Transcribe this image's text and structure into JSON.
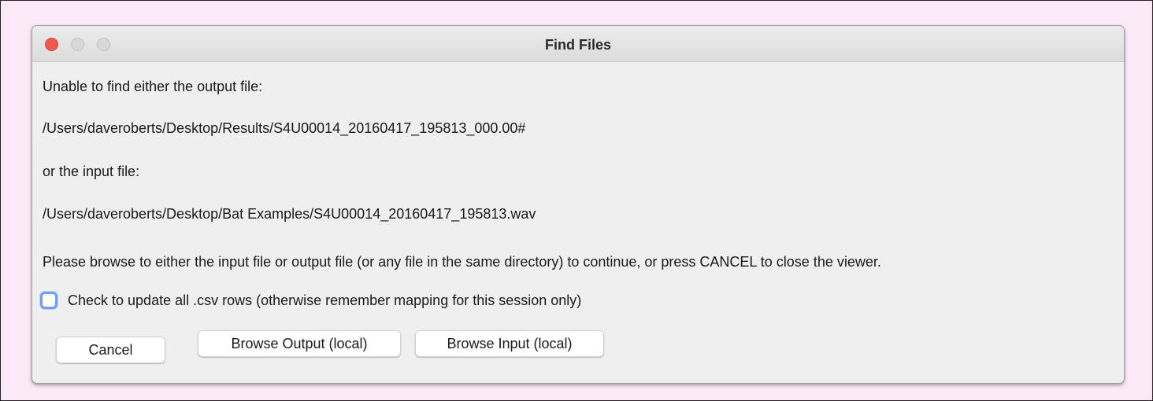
{
  "window": {
    "title": "Find Files"
  },
  "message": {
    "line1": "Unable to find either the output file:",
    "output_path": "/Users/daveroberts/Desktop/Results/S4U00014_20160417_195813_000.00#",
    "line3": "or the input file:",
    "input_path": "/Users/daveroberts/Desktop/Bat Examples/S4U00014_20160417_195813.wav",
    "instructions": "Please browse to either the input file or output file (or any file in the same directory) to continue, or press CANCEL to close the viewer."
  },
  "checkbox": {
    "label": "Check to update all .csv rows (otherwise remember mapping for this session only)",
    "checked": false
  },
  "buttons": {
    "cancel": "Cancel",
    "browse_output": "Browse Output (local)",
    "browse_input": "Browse Input (local)"
  },
  "colors": {
    "page_background": "#fce9f8",
    "close_button": "#ef5a50",
    "checkbox_focus": "#6f9ef2"
  }
}
